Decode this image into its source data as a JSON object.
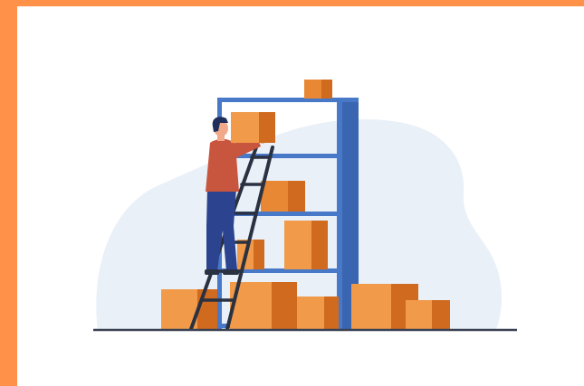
{
  "colors": {
    "accent_border": "#ff9148",
    "background": "#ffffff",
    "blob": "#e9f0f8",
    "shelf_frame": "#4878c8",
    "shelf_side": "#3a65b0",
    "box_light": "#f09a4a",
    "box_mid": "#e98834",
    "box_dark": "#d06a1e",
    "ladder": "#2a3140",
    "shirt": "#c8553d",
    "pants": "#2c4490",
    "hair": "#1f2f5a",
    "skin": "#f2a98a",
    "floor": "#3a4152"
  },
  "illustration": {
    "subject": "warehouse-worker-on-ladder-icon"
  }
}
